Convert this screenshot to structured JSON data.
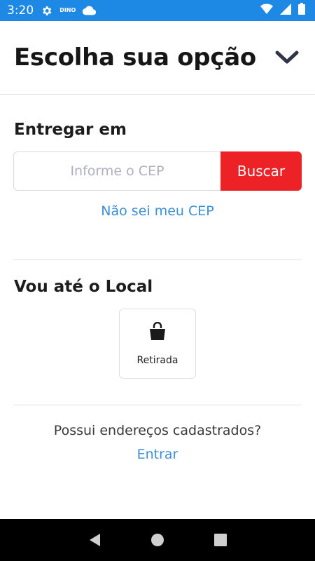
{
  "status_bar": {
    "time": "3:20",
    "icons": [
      "settings-icon",
      "dino-app-icon",
      "cloud-icon",
      "wifi-icon",
      "signal-icon",
      "battery-icon"
    ],
    "dino_label": "DINO",
    "color": "#1e88e5"
  },
  "header": {
    "title": "Escolha sua opção",
    "toggle_icon": "chevron-down-icon"
  },
  "delivery": {
    "title": "Entregar em",
    "cep_placeholder": "Informe o CEP",
    "cep_value": "",
    "search_label": "Buscar",
    "search_color": "#ec2227",
    "unknown_cep_link": "Não sei meu CEP"
  },
  "pickup": {
    "title": "Vou até o Local",
    "option_label": "Retirada",
    "option_icon": "shopping-bag-icon"
  },
  "account": {
    "question": "Possui endereços cadastrados?",
    "login_link": "Entrar"
  },
  "nav_bar": {
    "icons": [
      "back-icon",
      "home-icon",
      "recents-icon"
    ]
  },
  "colors": {
    "link": "#3b8fd9",
    "accent": "#ec2227"
  }
}
